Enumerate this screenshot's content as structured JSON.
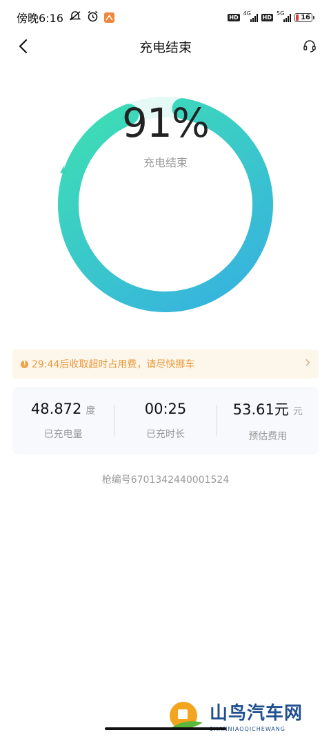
{
  "status_bar": {
    "time": "傍晚6:16",
    "network_1": "4G",
    "network_2": "5G",
    "hd_1": "HD",
    "hd_2": "HD",
    "battery": "16",
    "battery_level_percent": 16
  },
  "header": {
    "title": "充电结束"
  },
  "ring": {
    "percent_value": 91,
    "percent_text": "91%",
    "status": "充电结束",
    "colors": {
      "start": "#36b3e2",
      "end": "#3ddbb5",
      "track": "#e6faf5"
    }
  },
  "notice": {
    "text": "29:44后收取超时占用费，请尽快挪车"
  },
  "stats": [
    {
      "value": "48.872",
      "unit": "度",
      "label": "已充电量"
    },
    {
      "value": "00:25",
      "unit": "",
      "label": "已充时长"
    },
    {
      "value": "53.61元",
      "unit": "元",
      "label": "预估费用"
    }
  ],
  "gun_number": "枪编号6701342440001524",
  "watermark": {
    "title": "山鸟汽车网",
    "subtitle": "SHANNIAOQICHEWANG"
  }
}
